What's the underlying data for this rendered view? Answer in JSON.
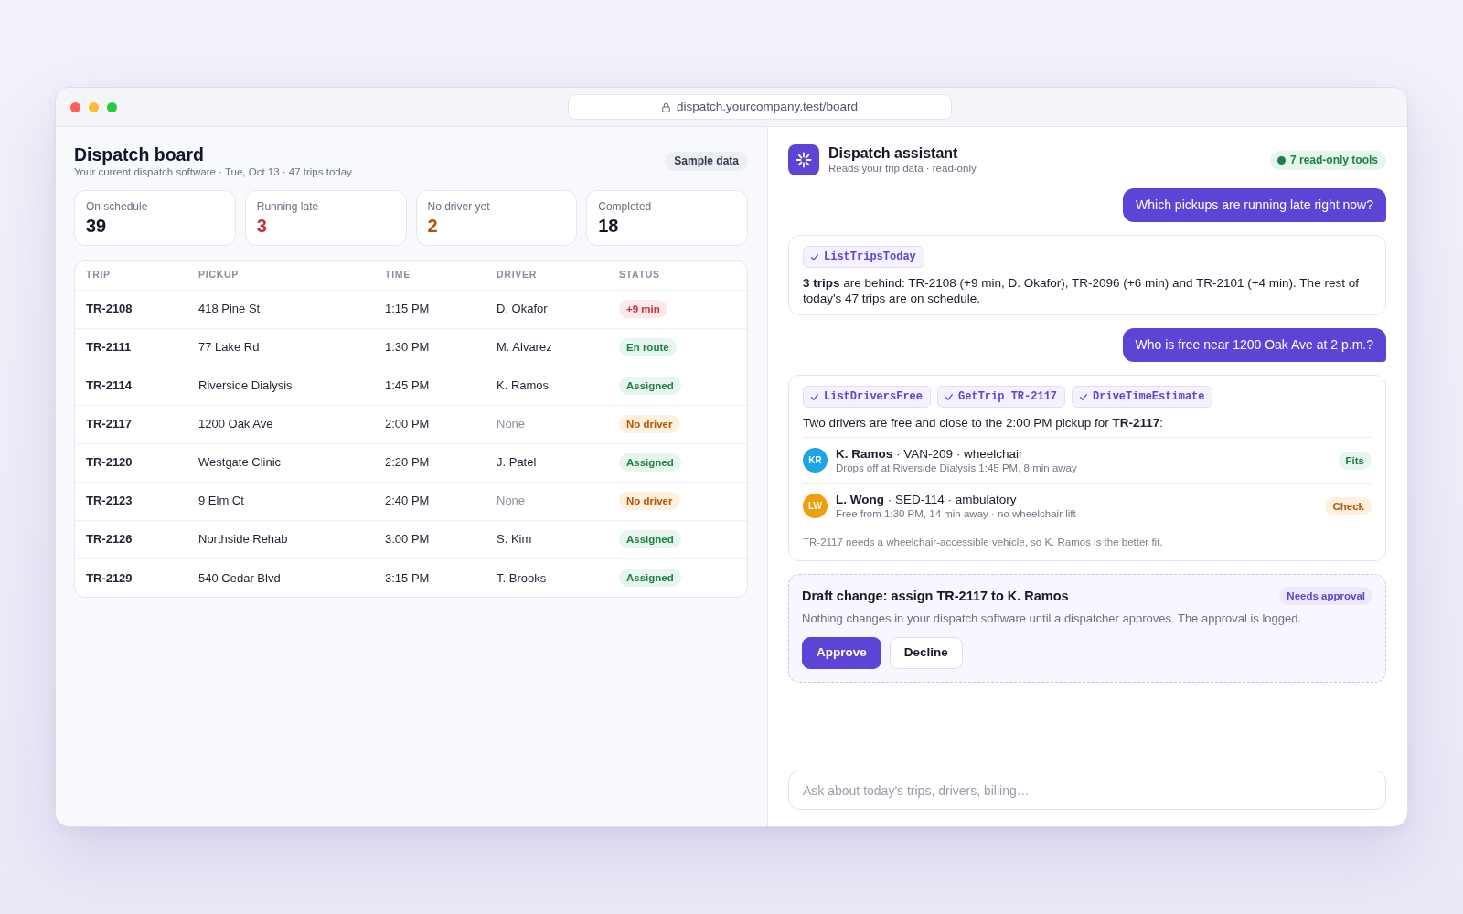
{
  "browser": {
    "url": "dispatch.yourcompany.test/board"
  },
  "board": {
    "title": "Dispatch board",
    "subtitle": "Your current dispatch software · Tue, Oct 13 · 47 trips today",
    "badge": "Sample data",
    "stats": [
      {
        "label": "On schedule",
        "value": "39",
        "color": "#111827"
      },
      {
        "label": "Running late",
        "value": "3",
        "color": "#c2343b"
      },
      {
        "label": "No driver yet",
        "value": "2",
        "color": "#b45309"
      },
      {
        "label": "Completed",
        "value": "18",
        "color": "#111827"
      }
    ],
    "table": {
      "columns": [
        "TRIP",
        "PICKUP",
        "TIME",
        "DRIVER",
        "STATUS"
      ],
      "rows": [
        {
          "trip": "TR-2108",
          "pickup": "418 Pine St",
          "time": "1:15 PM",
          "driver": "D. Okafor",
          "status": {
            "text": "+9 min",
            "kind": "late"
          }
        },
        {
          "trip": "TR-2111",
          "pickup": "77 Lake Rd",
          "time": "1:30 PM",
          "driver": "M. Alvarez",
          "status": {
            "text": "En route",
            "kind": "ok"
          }
        },
        {
          "trip": "TR-2114",
          "pickup": "Riverside Dialysis",
          "time": "1:45 PM",
          "driver": "K. Ramos",
          "status": {
            "text": "Assigned",
            "kind": "ok"
          }
        },
        {
          "trip": "TR-2117",
          "pickup": "1200 Oak Ave",
          "time": "2:00 PM",
          "driver": "None",
          "status": {
            "text": "No driver",
            "kind": "unassigned"
          }
        },
        {
          "trip": "TR-2120",
          "pickup": "Westgate Clinic",
          "time": "2:20 PM",
          "driver": "J. Patel",
          "status": {
            "text": "Assigned",
            "kind": "ok"
          }
        },
        {
          "trip": "TR-2123",
          "pickup": "9 Elm Ct",
          "time": "2:40 PM",
          "driver": "None",
          "status": {
            "text": "No driver",
            "kind": "unassigned"
          }
        },
        {
          "trip": "TR-2126",
          "pickup": "Northside Rehab",
          "time": "3:00 PM",
          "driver": "S. Kim",
          "status": {
            "text": "Assigned",
            "kind": "ok"
          }
        },
        {
          "trip": "TR-2129",
          "pickup": "540 Cedar Blvd",
          "time": "3:15 PM",
          "driver": "T. Brooks",
          "status": {
            "text": "Assigned",
            "kind": "ok"
          }
        }
      ]
    }
  },
  "assistant": {
    "title": "Dispatch assistant",
    "subtitle": "Reads your trip data · read-only",
    "tools_badge": "7 read-only tools",
    "messages": [
      {
        "kind": "user",
        "text": "Which pickups are running late right now?"
      },
      {
        "kind": "answer",
        "tools": [
          "ListTripsToday"
        ],
        "text": "**3 trips** are behind: TR-2108 (+9 min, D. Okafor), TR-2096 (+6 min) and TR-2101 (+4 min). The rest of today's 47 trips are on schedule."
      },
      {
        "kind": "user",
        "text": "Who is free near 1200 Oak Ave at 2 p.m.?"
      },
      {
        "kind": "answer",
        "tools": [
          "ListDriversFree",
          "GetTrip TR-2117",
          "DriveTimeEstimate"
        ],
        "text": "Two drivers are free and close to the 2:00 PM pickup for **TR-2117**:",
        "drivers": [
          {
            "initials": "KR",
            "color": "#1ea3e3",
            "summary": "**K. Ramos** · VAN-209 · wheelchair",
            "details": "Drops off at Riverside Dialysis 1:45 PM, 8 min away",
            "fit": {
              "text": "Fits",
              "kind": "ok"
            }
          },
          {
            "initials": "LW",
            "color": "#f29e0c",
            "summary": "**L. Wong** · SED-114 · ambulatory",
            "details": "Free from 1:30 PM, 14 min away · no wheelchair lift",
            "fit": {
              "text": "Check",
              "kind": "unassigned"
            }
          }
        ],
        "note": "TR-2117 needs a wheelchair-accessible vehicle, so K. Ramos is the better fit."
      },
      {
        "kind": "draft",
        "title": "Draft change: assign TR-2117 to K. Ramos",
        "badge": "Needs approval",
        "text": "Nothing changes in your dispatch software until a dispatcher approves. The approval is logged.",
        "actions": [
          {
            "label": "Approve",
            "kind": "primary"
          },
          {
            "label": "Decline",
            "kind": "secondary"
          }
        ]
      }
    ],
    "input": {
      "placeholder": "Ask about today's trips, drivers, billing…"
    }
  }
}
